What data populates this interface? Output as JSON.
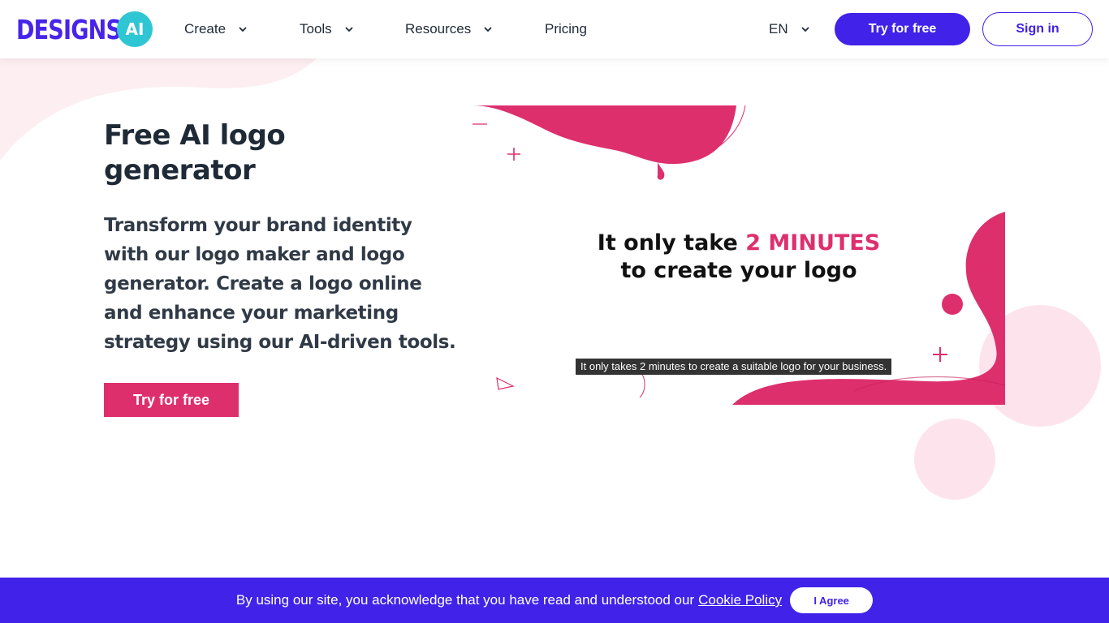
{
  "header": {
    "logo_text": "DESIGNS.",
    "logo_badge": "AI",
    "nav": [
      {
        "label": "Create",
        "icon": "chevron-down-icon"
      },
      {
        "label": "Tools",
        "icon": "chevron-down-icon"
      },
      {
        "label": "Resources",
        "icon": "chevron-down-icon"
      },
      {
        "label": "Pricing"
      }
    ],
    "language": "EN",
    "try_label": "Try for free",
    "signin_label": "Sign in"
  },
  "hero": {
    "title": "Free AI logo generator",
    "description": "Transform your brand identity with our logo maker and logo generator. Create a logo online and enhance your marketing strategy using our AI-driven tools.",
    "cta_label": "Try for free"
  },
  "promo": {
    "headline_part1": "It only take ",
    "headline_accent": "2 MINUTES",
    "headline_part2": "to create your logo",
    "caption": "It only takes 2 minutes to create a suitable logo for your business."
  },
  "cookie": {
    "text": "By using our site, you acknowledge that you have read and understood our",
    "link_label": "Cookie Policy",
    "agree_label": "I Agree"
  },
  "colors": {
    "brand_purple": "#4122e8",
    "accent_pink": "#de2f6d",
    "logo_teal": "#2fc6d4",
    "soft_pink": "#fde4ec"
  }
}
